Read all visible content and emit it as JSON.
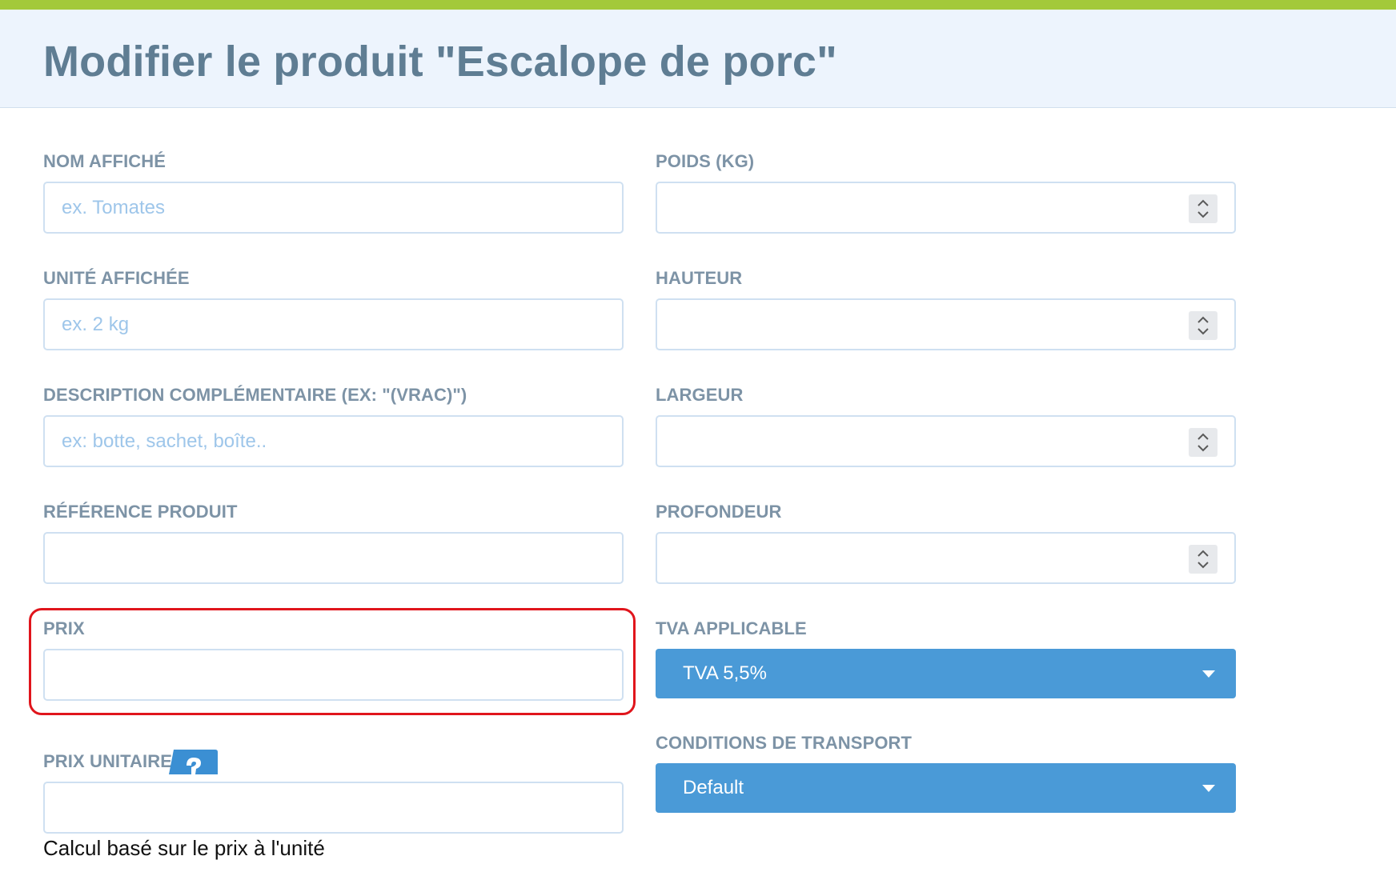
{
  "header": {
    "title": "Modifier le produit \"Escalope de porc\""
  },
  "form": {
    "left": {
      "nom_affiche": {
        "label": "NOM AFFICHÉ",
        "placeholder": "ex. Tomates",
        "value": ""
      },
      "unite_affichee": {
        "label": "UNITÉ AFFICHÉE",
        "placeholder": "ex. 2 kg",
        "value": ""
      },
      "description": {
        "label": "DESCRIPTION COMPLÉMENTAIRE (EX: \"(VRAC)\")",
        "placeholder": "ex: botte, sachet, boîte..",
        "value": ""
      },
      "reference": {
        "label": "RÉFÉRENCE PRODUIT",
        "value": ""
      },
      "prix": {
        "label": "PRIX",
        "value": ""
      },
      "prix_unitaire": {
        "label": "PRIX UNITAIRE",
        "value": "",
        "help_icon": "question-icon",
        "note": "Calcul basé sur le prix à l'unité"
      }
    },
    "right": {
      "poids": {
        "label": "POIDS (KG)",
        "value": ""
      },
      "hauteur": {
        "label": "HAUTEUR",
        "value": ""
      },
      "largeur": {
        "label": "LARGEUR",
        "value": ""
      },
      "profondeur": {
        "label": "PROFONDEUR",
        "value": ""
      },
      "tva": {
        "label": "TVA APPLICABLE",
        "selected": "TVA 5,5%"
      },
      "transport": {
        "label": "CONDITIONS DE TRANSPORT",
        "selected": "Default"
      }
    }
  },
  "colors": {
    "top_bar": "#a3c93a",
    "header_bg": "#edf4fd",
    "title": "#5f7d93",
    "label": "#7d93a6",
    "placeholder": "#9ec6ea",
    "input_border": "#cfe0f1",
    "select_bg": "#4a9ad7",
    "highlight": "#e0151c"
  }
}
